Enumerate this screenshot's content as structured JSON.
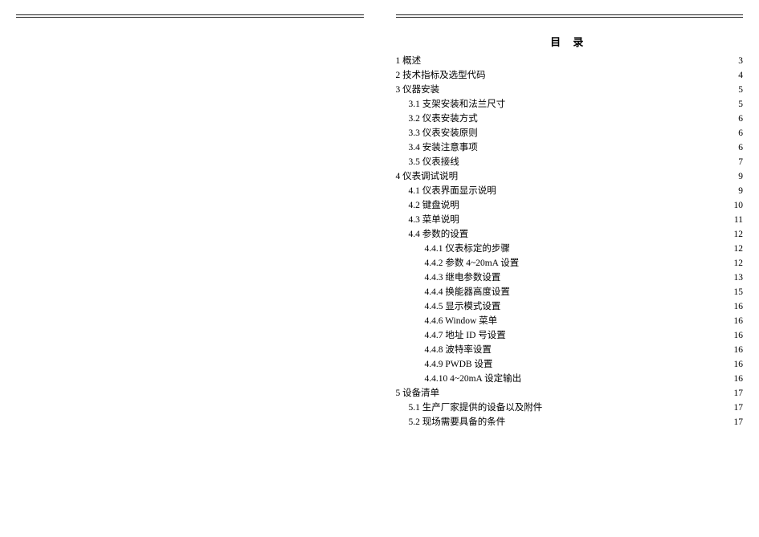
{
  "toc_title": "目  录",
  "entries": [
    {
      "indent": 0,
      "label": "1 概述",
      "page": "3"
    },
    {
      "indent": 0,
      "label": "2  技术指标及选型代码",
      "page": "4"
    },
    {
      "indent": 0,
      "label": "3 仪器安装",
      "page": "5"
    },
    {
      "indent": 1,
      "label": "3.1  支架安装和法兰尺寸",
      "page": "5"
    },
    {
      "indent": 1,
      "label": "3.2  仪表安装方式",
      "page": "6"
    },
    {
      "indent": 1,
      "label": "3.3  仪表安装原则",
      "page": "6"
    },
    {
      "indent": 1,
      "label": "3.4  安装注意事项",
      "page": "6"
    },
    {
      "indent": 1,
      "label": "3.5  仪表接线",
      "page": "7"
    },
    {
      "indent": 0,
      "label": "4 仪表调试说明",
      "page": "9"
    },
    {
      "indent": 1,
      "label": "4.1  仪表界面显示说明",
      "page": "9"
    },
    {
      "indent": 1,
      "label": "4.2 键盘说明",
      "page": "10"
    },
    {
      "indent": 1,
      "label": "4.3 菜单说明",
      "page": "11"
    },
    {
      "indent": 1,
      "label": "4.4  参数的设置",
      "page": "12"
    },
    {
      "indent": 2,
      "label": "4.4.1  仪表标定的步骤",
      "page": "12"
    },
    {
      "indent": 2,
      "label": "4.4.2 参数 4~20mA 设置",
      "page": "12"
    },
    {
      "indent": 2,
      "label": "4.4.3  继电参数设置",
      "page": "13"
    },
    {
      "indent": 2,
      "label": "4.4.4  换能器高度设置",
      "page": "15"
    },
    {
      "indent": 2,
      "label": "4.4.5  显示模式设置",
      "page": "16"
    },
    {
      "indent": 2,
      "label": "4.4.6  Window  菜单",
      "page": "16"
    },
    {
      "indent": 2,
      "label": "4.4.7 地址 ID 号设置",
      "page": "16"
    },
    {
      "indent": 2,
      "label": "4.4.8  波特率设置",
      "page": "16"
    },
    {
      "indent": 2,
      "label": "4.4.9 PWDB 设置",
      "page": "16"
    },
    {
      "indent": 2,
      "label": "4.4.10  4~20mA 设定输出",
      "page": "16"
    },
    {
      "indent": 0,
      "label": "5 设备清单",
      "page": "17"
    },
    {
      "indent": 1,
      "label": "5.1  生产厂家提供的设备以及附件",
      "page": "17"
    },
    {
      "indent": 1,
      "label": "5.2 现场需要具备的条件",
      "page": "17"
    }
  ]
}
